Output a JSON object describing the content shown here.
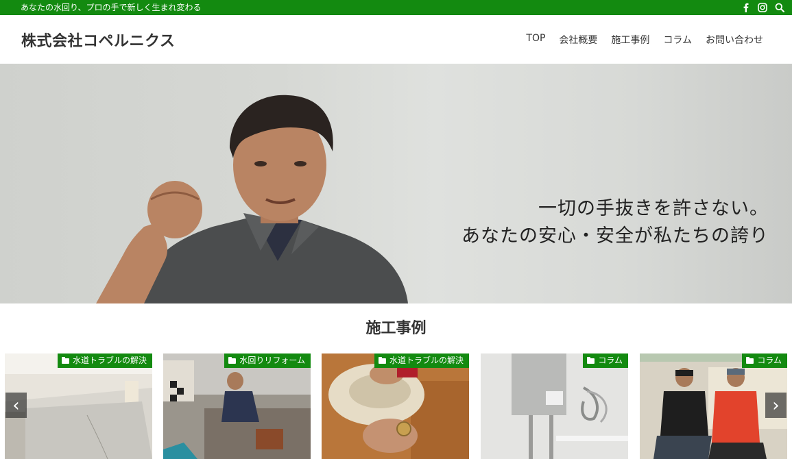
{
  "topbar": {
    "tagline": "あなたの水回り、プロの手で新しく生まれ変わる",
    "icons": [
      "facebook-icon",
      "instagram-icon",
      "search-icon"
    ]
  },
  "header": {
    "logo": "株式会社コペルニクス",
    "nav": [
      "TOP",
      "会社概要",
      "施工事例",
      "コラム",
      "お問い合わせ"
    ]
  },
  "hero": {
    "line1": "一切の手抜きを許さない。",
    "line2": "あなたの安心・安全が私たちの誇り"
  },
  "section": {
    "title": "施工事例"
  },
  "cards": [
    {
      "category": "水道トラブルの解決"
    },
    {
      "category": "水回りリフォーム"
    },
    {
      "category": "水道トラブルの解決"
    },
    {
      "category": "コラム"
    },
    {
      "category": "コラム"
    }
  ],
  "slider": {
    "prev": "‹",
    "next": "›"
  },
  "colors": {
    "brand_green": "#138a10"
  }
}
